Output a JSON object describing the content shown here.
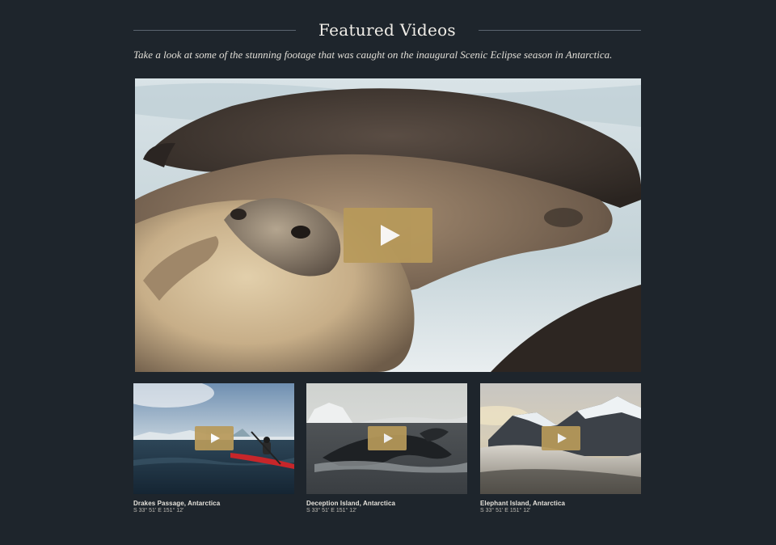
{
  "section": {
    "title": "Featured Videos",
    "subtitle": "Take a look at some of the stunning footage that was caught on the inaugural Scenic Eclipse season in Antarctica."
  },
  "hero": {
    "play_icon": "play-icon"
  },
  "videos": [
    {
      "title": "Drakes Passage, Antarctica",
      "coords": "S 33° 51' E 151° 12'"
    },
    {
      "title": "Deception Island, Antarctica",
      "coords": "S 33° 51' E 151° 12'"
    },
    {
      "title": "Elephant Island, Antarctica",
      "coords": "S 33° 51' E 151° 12'"
    }
  ],
  "colors": {
    "background": "#1e252c",
    "play_button": "#b89a5a",
    "rule": "#5b6470"
  }
}
